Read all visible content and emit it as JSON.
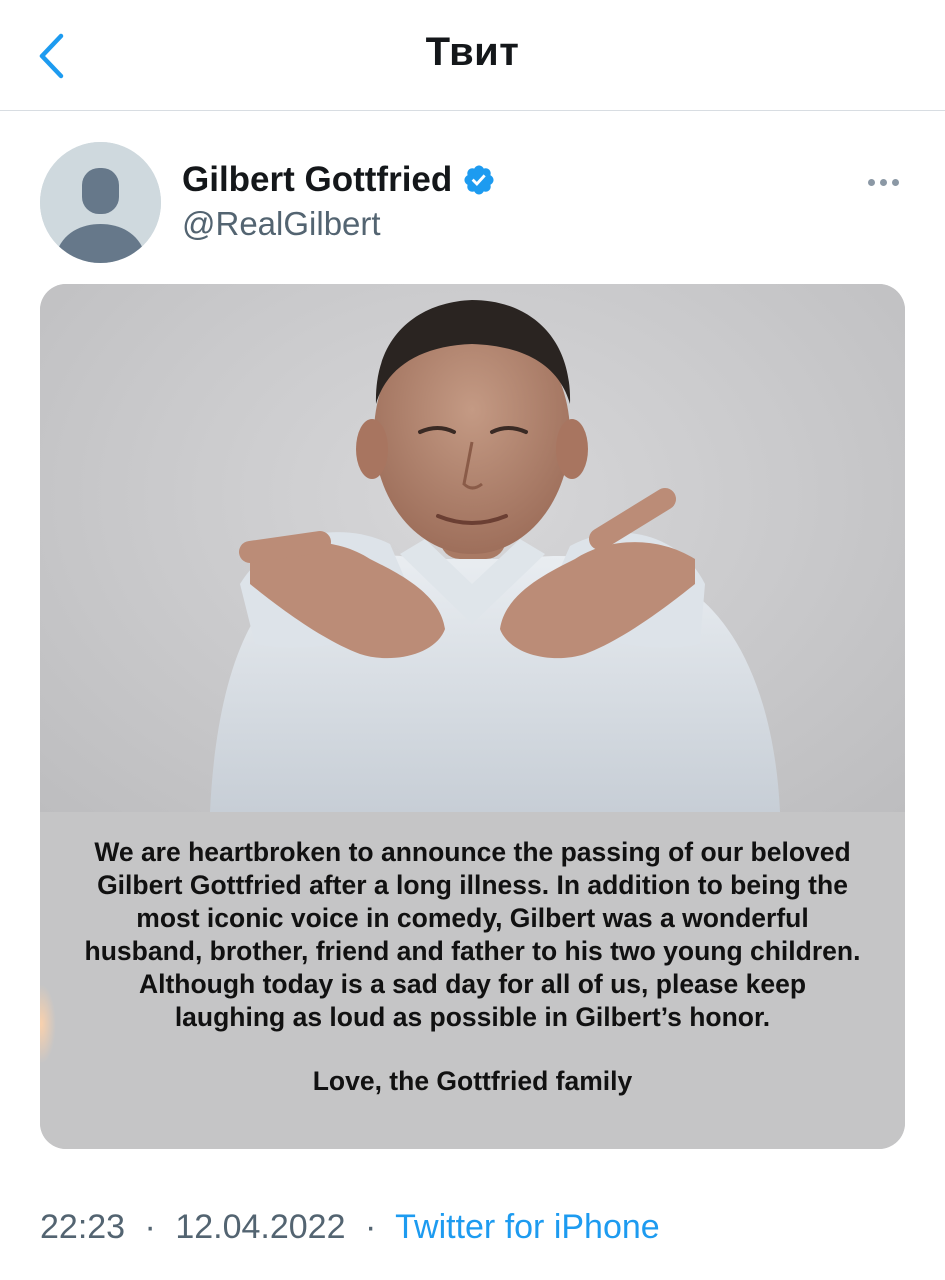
{
  "header": {
    "title": "Твит",
    "back_icon": "chevron-left-icon",
    "accent_color": "#1d9bf0"
  },
  "author": {
    "name": "Gilbert Gottfried",
    "handle": "@RealGilbert",
    "verified": true,
    "verified_icon": "verified-badge-icon",
    "avatar_icon": "default-avatar-icon",
    "more_icon": "more-horizontal-icon"
  },
  "media": {
    "photo_description_icon": "person-photo",
    "statement_text": "We are heartbroken to announce the passing of our beloved\nGilbert Gottfried after a long illness.  In addition to being the\nmost iconic voice in comedy, Gilbert was a wonderful\nhusband, brother, friend and father to his two young children.\nAlthough today is a sad day for all of us, please keep\nlaughing as loud as possible in Gilbert’s honor.",
    "signoff": "Love, the Gottfried family"
  },
  "meta": {
    "time": "22:23",
    "date": "12.04.2022",
    "separator": "·",
    "source": "Twitter for iPhone"
  }
}
